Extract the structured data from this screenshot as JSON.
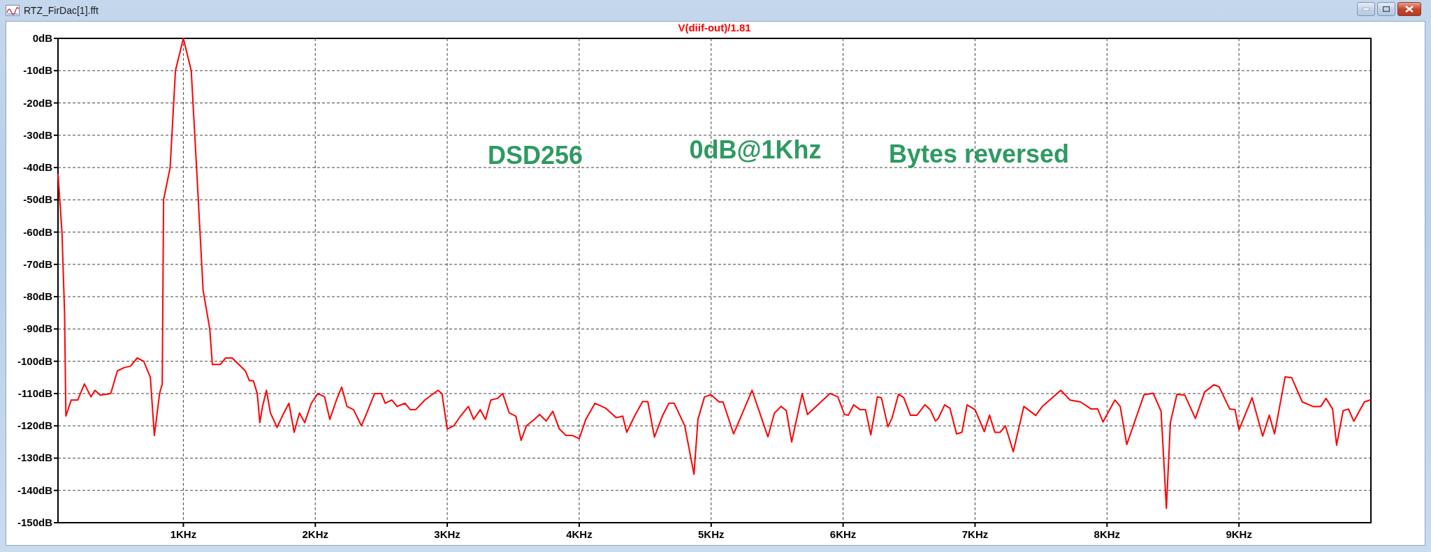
{
  "window": {
    "title": "RTZ_FirDac[1].fft"
  },
  "plot": {
    "chart_data": {
      "type": "line",
      "grid": true,
      "xlim": [
        0.05,
        10
      ],
      "ylim": [
        -150,
        0
      ],
      "xticks": [
        {
          "value": 1,
          "label": "1KHz"
        },
        {
          "value": 2,
          "label": "2KHz"
        },
        {
          "value": 3,
          "label": "3KHz"
        },
        {
          "value": 4,
          "label": "4KHz"
        },
        {
          "value": 5,
          "label": "5KHz"
        },
        {
          "value": 6,
          "label": "6KHz"
        },
        {
          "value": 7,
          "label": "7KHz"
        },
        {
          "value": 8,
          "label": "8KHz"
        },
        {
          "value": 9,
          "label": "9KHz"
        }
      ],
      "yticks": [
        {
          "value": 0,
          "label": "0dB"
        },
        {
          "value": -10,
          "label": "-10dB"
        },
        {
          "value": -20,
          "label": "-20dB"
        },
        {
          "value": -30,
          "label": "-30dB"
        },
        {
          "value": -40,
          "label": "-40dB"
        },
        {
          "value": -50,
          "label": "-50dB"
        },
        {
          "value": -60,
          "label": "-60dB"
        },
        {
          "value": -70,
          "label": "-70dB"
        },
        {
          "value": -80,
          "label": "-80dB"
        },
        {
          "value": -90,
          "label": "-90dB"
        },
        {
          "value": -100,
          "label": "-100dB"
        },
        {
          "value": -110,
          "label": "-110dB"
        },
        {
          "value": -120,
          "label": "-120dB"
        },
        {
          "value": -130,
          "label": "-130dB"
        },
        {
          "value": -140,
          "label": "-140dB"
        },
        {
          "value": -150,
          "label": "-150dB"
        }
      ],
      "x": [
        0.05,
        0.08,
        0.1,
        0.11,
        0.15,
        0.2,
        0.25,
        0.3,
        0.33,
        0.37,
        0.45,
        0.5,
        0.55,
        0.6,
        0.65,
        0.7,
        0.75,
        0.78,
        0.82,
        0.84,
        0.85,
        0.9,
        0.94,
        1.0,
        1.06,
        1.1,
        1.15,
        1.2,
        1.22,
        1.28,
        1.32,
        1.37,
        1.42,
        1.47,
        1.5,
        1.53,
        1.56,
        1.58,
        1.6,
        1.63,
        1.66,
        1.71,
        1.75,
        1.8,
        1.84,
        1.88,
        1.92,
        1.97,
        2.02,
        2.07,
        2.11,
        2.16,
        2.2,
        2.24,
        2.29,
        2.35,
        2.4,
        2.45,
        2.5,
        2.53,
        2.58,
        2.62,
        2.68,
        2.72,
        2.76,
        2.83,
        2.93,
        2.96,
        3.0,
        3.05,
        3.1,
        3.16,
        3.2,
        3.25,
        3.29,
        3.33,
        3.38,
        3.42,
        3.47,
        3.52,
        3.56,
        3.6,
        3.66,
        3.7,
        3.75,
        3.8,
        3.85,
        3.9,
        3.95,
        4.0,
        4.05,
        4.12,
        4.2,
        4.28,
        4.33,
        4.36,
        4.42,
        4.48,
        4.52,
        4.57,
        4.63,
        4.68,
        4.72,
        4.8,
        4.87,
        4.9,
        4.95,
        5.0,
        5.06,
        5.09,
        5.17,
        5.31,
        5.43,
        5.48,
        5.53,
        5.57,
        5.61,
        5.69,
        5.73,
        5.9,
        5.96,
        6.01,
        6.04,
        6.08,
        6.13,
        6.17,
        6.21,
        6.26,
        6.29,
        6.34,
        6.37,
        6.42,
        6.46,
        6.51,
        6.56,
        6.62,
        6.66,
        6.7,
        6.72,
        6.77,
        6.81,
        6.86,
        6.9,
        6.94,
        7.0,
        7.07,
        7.11,
        7.15,
        7.19,
        7.23,
        7.29,
        7.37,
        7.46,
        7.51,
        7.65,
        7.72,
        7.8,
        7.88,
        7.93,
        7.97,
        8.06,
        8.1,
        8.15,
        8.28,
        8.35,
        8.41,
        8.45,
        8.48,
        8.53,
        8.59,
        8.67,
        8.74,
        8.81,
        8.85,
        8.93,
        8.97,
        9.0,
        9.1,
        9.18,
        9.23,
        9.27,
        9.35,
        9.4,
        9.48,
        9.56,
        9.62,
        9.66,
        9.71,
        9.74,
        9.79,
        9.83,
        9.87,
        9.95,
        10.0
      ],
      "series": [
        {
          "name": "V(diif-out)/1.81",
          "color": "#ff0000",
          "values": [
            -42,
            -60,
            -85,
            -117,
            -112,
            -112,
            -107,
            -111,
            -109,
            -110.5,
            -110,
            -103,
            -102,
            -101.5,
            -99,
            -100,
            -105,
            -123,
            -110,
            -107,
            -50,
            -40,
            -10,
            0,
            -10,
            -40,
            -78,
            -90,
            -101,
            -101,
            -99,
            -99,
            -101,
            -103,
            -106,
            -106,
            -110,
            -119,
            -114,
            -109,
            -116,
            -120.5,
            -117,
            -113,
            -122,
            -116,
            -119,
            -113,
            -110,
            -111,
            -118,
            -112,
            -108,
            -114,
            -115,
            -120,
            -115,
            -110,
            -110,
            -113,
            -112,
            -114,
            -113,
            -115,
            -115,
            -112,
            -109,
            -110,
            -121,
            -120,
            -117,
            -114,
            -118,
            -115,
            -118,
            -112,
            -111.5,
            -110,
            -116,
            -117,
            -124.5,
            -120,
            -118,
            -116.5,
            -118.5,
            -115.5,
            -121,
            -123,
            -123,
            -124,
            -118,
            -113,
            -114.5,
            -117.5,
            -117,
            -122,
            -117,
            -112.5,
            -112.5,
            -123.5,
            -117,
            -113,
            -113,
            -120,
            -135,
            -118,
            -111,
            -110.4,
            -112.6,
            -112.6,
            -122.5,
            -109,
            -123.4,
            -116,
            -114,
            -115.3,
            -125,
            -110,
            -116.5,
            -110,
            -111,
            -116.5,
            -116.7,
            -113.5,
            -115,
            -115,
            -122.8,
            -111,
            -111.3,
            -120.3,
            -117.7,
            -110.2,
            -111.3,
            -116.7,
            -116.7,
            -113.5,
            -115,
            -118.5,
            -117.8,
            -113.5,
            -114.6,
            -122.5,
            -122,
            -113.5,
            -115,
            -121.8,
            -116.7,
            -122,
            -122,
            -120,
            -128,
            -114,
            -116.8,
            -114,
            -109,
            -112,
            -112.6,
            -114.8,
            -114.8,
            -118.8,
            -112,
            -114,
            -125.8,
            -110.4,
            -109.9,
            -115.5,
            -145.6,
            -119,
            -110.2,
            -110.5,
            -117.7,
            -109.5,
            -107.3,
            -107.9,
            -114.8,
            -115,
            -121.2,
            -111.3,
            -123.2,
            -116.7,
            -122.5,
            -104.8,
            -105.1,
            -112.6,
            -114,
            -114,
            -111.5,
            -114.8,
            -126,
            -115.3,
            -114.8,
            -118.6,
            -112.6,
            -111.9
          ]
        }
      ],
      "annotations": [
        "DSD256",
        "0dB@1Khz",
        "Bytes reversed"
      ]
    }
  }
}
